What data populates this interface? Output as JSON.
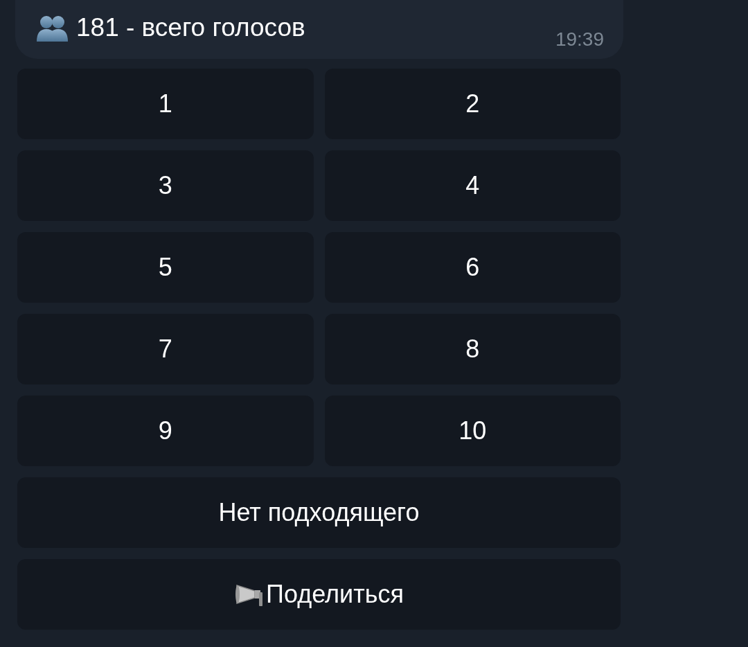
{
  "message": {
    "text": "181 - всего голосов",
    "time": "19:39"
  },
  "keyboard": [
    [
      {
        "label": "1",
        "kind": "plain"
      },
      {
        "label": "2",
        "kind": "plain"
      }
    ],
    [
      {
        "label": "3",
        "kind": "plain"
      },
      {
        "label": "4",
        "kind": "plain"
      }
    ],
    [
      {
        "label": "5",
        "kind": "plain"
      },
      {
        "label": "6",
        "kind": "plain"
      }
    ],
    [
      {
        "label": "7",
        "kind": "plain"
      },
      {
        "label": "8",
        "kind": "plain"
      }
    ],
    [
      {
        "label": "9",
        "kind": "plain"
      },
      {
        "label": "10",
        "kind": "plain"
      }
    ],
    [
      {
        "label": "Нет подходящего",
        "kind": "plain"
      }
    ],
    [
      {
        "label": "Поделиться",
        "kind": "share"
      }
    ]
  ]
}
